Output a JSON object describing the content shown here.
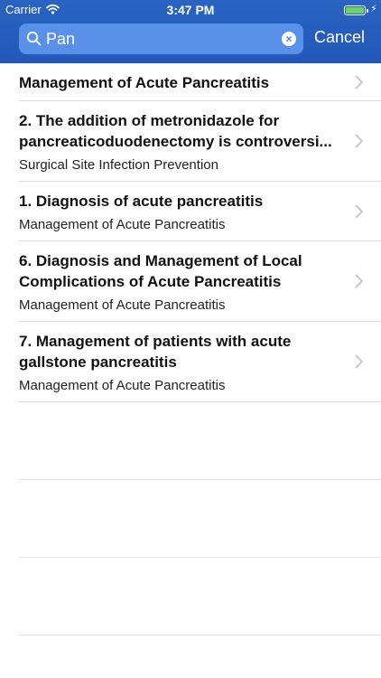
{
  "status_bar": {
    "carrier": "Carrier",
    "time": "3:47 PM"
  },
  "search": {
    "query": "Pan",
    "cancel_label": "Cancel"
  },
  "results": [
    {
      "title": "Management of Acute Pancreatitis",
      "subtitle": ""
    },
    {
      "title": "2. The addition of metronidazole for pancreaticoduodenectomy is controversi...",
      "subtitle": "Surgical Site Infection Prevention"
    },
    {
      "title": "1. Diagnosis of acute pancreatitis",
      "subtitle": "Management of Acute Pancreatitis"
    },
    {
      "title": "6. Diagnosis and Management of Local Complications of Acute Pancreatitis",
      "subtitle": "Management of Acute Pancreatitis"
    },
    {
      "title": "7. Management of patients with acute gallstone pancreatitis",
      "subtitle": "Management of Acute Pancreatitis"
    }
  ],
  "colors": {
    "header": "#2358b8",
    "search_field": "#5a91e8",
    "battery": "#6dd26a",
    "separator": "#d9d9de"
  },
  "icons": {
    "search": "search-icon",
    "clear": "clear-icon",
    "chevron": "chevron-right-icon",
    "wifi": "wifi-icon",
    "battery": "battery-icon"
  }
}
